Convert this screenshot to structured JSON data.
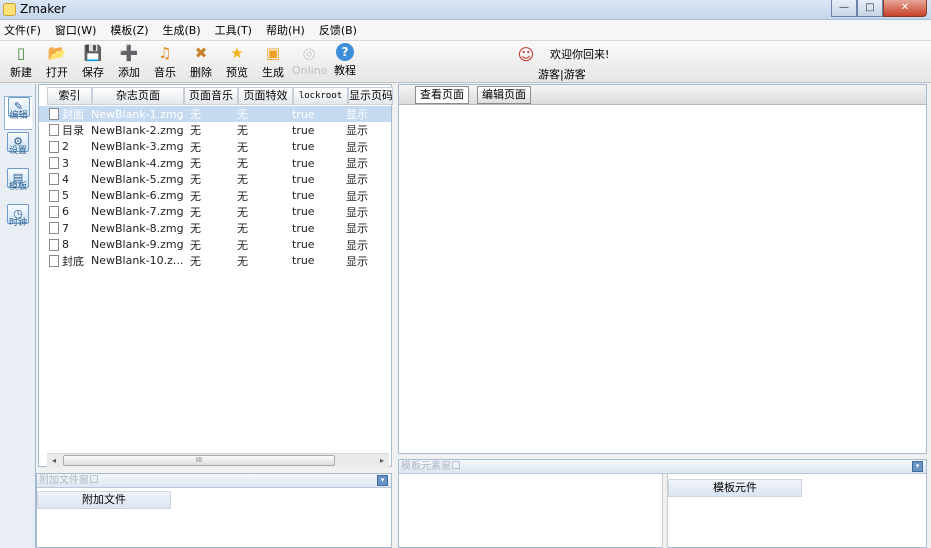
{
  "window": {
    "title": "Zmaker",
    "minimize": "—",
    "maximize": "□",
    "close": "✕"
  },
  "menu": [
    "文件(F)",
    "窗口(W)",
    "模板(Z)",
    "生成(B)",
    "工具(T)",
    "帮助(H)",
    "反馈(B)"
  ],
  "toolbar": {
    "tools": [
      {
        "label": "新建",
        "icon": "new-file-icon",
        "glyph": "▯"
      },
      {
        "label": "打开",
        "icon": "open-folder-icon",
        "glyph": "📂"
      },
      {
        "label": "保存",
        "icon": "save-icon",
        "glyph": "💾"
      },
      {
        "label": "添加",
        "icon": "add-page-icon",
        "glyph": "➕"
      },
      {
        "label": "音乐",
        "icon": "music-icon",
        "glyph": "♫"
      },
      {
        "label": "删除",
        "icon": "delete-icon",
        "glyph": "✖"
      },
      {
        "label": "预览",
        "icon": "star-icon",
        "glyph": "★"
      },
      {
        "label": "生成",
        "icon": "build-icon",
        "glyph": "▣"
      },
      {
        "label": "Online",
        "icon": "online-icon",
        "glyph": "◎",
        "disabled": true
      },
      {
        "label": "教程",
        "icon": "help-icon",
        "glyph": "?"
      }
    ],
    "welcome": "欢迎你回来!",
    "guest": "游客|游客"
  },
  "side_tabs": [
    {
      "label": "编辑",
      "glyph": "✎",
      "active": true
    },
    {
      "label": "设置",
      "glyph": "⚙"
    },
    {
      "label": "模板",
      "glyph": "▤"
    },
    {
      "label": "时钟",
      "glyph": "◷"
    }
  ],
  "page_table": {
    "columns": [
      "索引",
      "杂志页面",
      "页面音乐",
      "页面特效",
      "lockroot",
      "显示页码"
    ],
    "rows": [
      [
        "封面",
        "NewBlank-1.zmg",
        "无",
        "无",
        "true",
        "显示"
      ],
      [
        "目录",
        "NewBlank-2.zmg",
        "无",
        "无",
        "true",
        "显示"
      ],
      [
        "2",
        "NewBlank-3.zmg",
        "无",
        "无",
        "true",
        "显示"
      ],
      [
        "3",
        "NewBlank-4.zmg",
        "无",
        "无",
        "true",
        "显示"
      ],
      [
        "4",
        "NewBlank-5.zmg",
        "无",
        "无",
        "true",
        "显示"
      ],
      [
        "5",
        "NewBlank-6.zmg",
        "无",
        "无",
        "true",
        "显示"
      ],
      [
        "6",
        "NewBlank-7.zmg",
        "无",
        "无",
        "true",
        "显示"
      ],
      [
        "7",
        "NewBlank-8.zmg",
        "无",
        "无",
        "true",
        "显示"
      ],
      [
        "8",
        "NewBlank-9.zmg",
        "无",
        "无",
        "true",
        "显示"
      ],
      [
        "封底",
        "NewBlank-10.z...",
        "无",
        "无",
        "true",
        "显示"
      ]
    ],
    "selected_row": 0,
    "scroll_left": "◂",
    "scroll_right": "▸",
    "scroll_grip": "III"
  },
  "attach_panel": {
    "title": "附加文件窗口",
    "column": "附加文件",
    "collapse": "▾"
  },
  "preview": {
    "tabs": [
      "查看页面",
      "编辑页面"
    ],
    "active_tab": 0
  },
  "template_panel": {
    "title": "模板元素窗口",
    "column": "模板元件",
    "collapse": "▾"
  }
}
